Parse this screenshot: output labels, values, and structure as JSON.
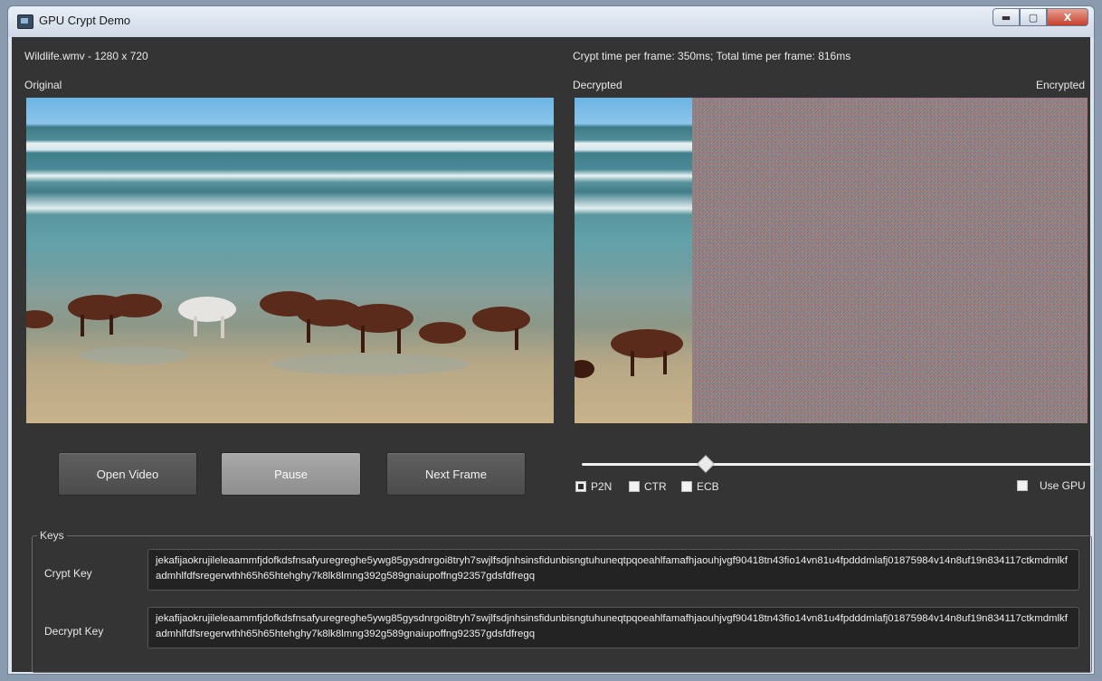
{
  "window": {
    "title": "GPU Crypt Demo",
    "controls": {
      "minimize": "▬",
      "maximize": "▢",
      "close": "X"
    }
  },
  "header": {
    "file_info": "Wildlife.wmv - 1280 x 720",
    "timing": "Crypt time per frame: 350ms;  Total time per frame: 816ms"
  },
  "panels": {
    "original_label": "Original",
    "decrypted_label": "Decrypted",
    "encrypted_label": "Encrypted"
  },
  "buttons": {
    "open_video": "Open Video",
    "pause": "Pause",
    "next_frame": "Next Frame"
  },
  "slider": {
    "value_fraction": 0.24
  },
  "modes": [
    {
      "label": "P2N",
      "checked": true
    },
    {
      "label": "CTR",
      "checked": false
    },
    {
      "label": "ECB",
      "checked": false
    }
  ],
  "use_gpu": {
    "label": "Use GPU",
    "checked": false
  },
  "keys": {
    "legend": "Keys",
    "crypt_label": "Crypt Key",
    "crypt_value": "jekafijaokrujileleaammfjdofkdsfnsafyuregreghe5ywg85gysdnrgoi8tryh7swjlfsdjnhsinsfidunbisngtuhuneqtpqoeahlfamafhjaouhjvgf90418tn43fio14vn81u4fpdddmlafj01875984v14n8uf19n834117ctkmdmlkfadmhlfdfsregerwthh65h65htehghy7k8lk8lmng392g589gnaiupoffng92357gdsfdfregq",
    "decrypt_label": "Decrypt Key",
    "decrypt_value": "jekafijaokrujileleaammfjdofkdsfnsafyuregreghe5ywg85gysdnrgoi8tryh7swjlfsdjnhsinsfidunbisngtuhuneqtpqoeahlfamafhjaouhjvgf90418tn43fio14vn81u4fpdddmlafj01875984v14n8uf19n834117ctkmdmlkfadmhlfdfsregerwthh65h65htehghy7k8lk8lmng392g589gnaiupoffng92357gdsfdfregq"
  }
}
